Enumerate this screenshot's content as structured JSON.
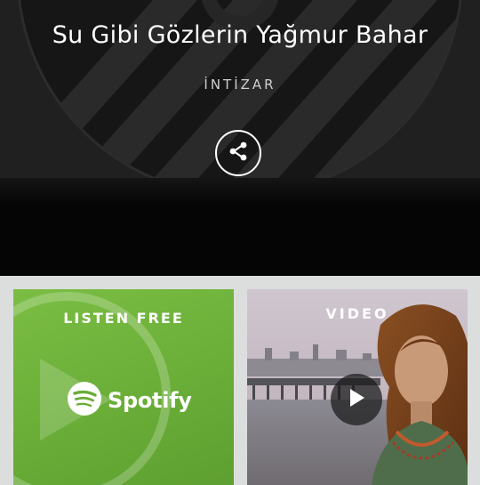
{
  "header": {
    "song_title": "Su Gibi Gözlerin Yağmur Bahar",
    "artist": "İNTİZAR",
    "share_icon": "share-icon"
  },
  "cards": {
    "spotify": {
      "label": "LISTEN FREE",
      "brand_name": "Spotify",
      "background_color": "#6aae38",
      "icon": "spotify-logo-icon"
    },
    "video": {
      "label": "VIDEO",
      "icon": "play-icon"
    }
  },
  "colors": {
    "hero_background": "#050505",
    "page_background": "#dcdedd",
    "text_primary": "#ffffff"
  }
}
